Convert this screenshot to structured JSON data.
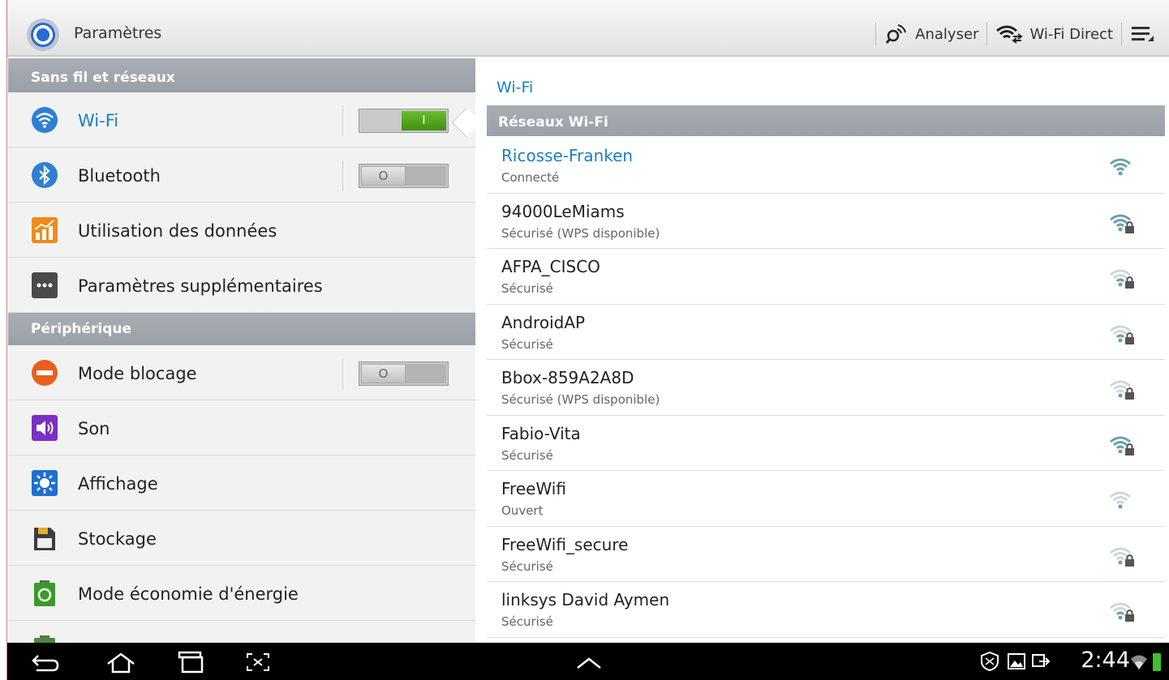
{
  "app": {
    "title": "Paramètres"
  },
  "actions": {
    "scan_label": "Analyser",
    "wifi_direct_label": "Wi-Fi Direct"
  },
  "sidebar": {
    "sections": [
      {
        "title": "Sans fil et réseaux"
      },
      {
        "title": "Périphérique"
      }
    ],
    "items": [
      {
        "label": "Wi-Fi",
        "icon": "wifi-icon",
        "toggle": "on",
        "toggle_text": "I"
      },
      {
        "label": "Bluetooth",
        "icon": "bluetooth-icon",
        "toggle": "off",
        "toggle_text": "O"
      },
      {
        "label": "Utilisation des données",
        "icon": "data-usage-icon"
      },
      {
        "label": "Paramètres supplémentaires",
        "icon": "more-settings-icon"
      },
      {
        "label": "Mode blocage",
        "icon": "blocking-mode-icon",
        "toggle": "off",
        "toggle_text": "O"
      },
      {
        "label": "Son",
        "icon": "sound-icon"
      },
      {
        "label": "Affichage",
        "icon": "display-icon"
      },
      {
        "label": "Stockage",
        "icon": "storage-icon"
      },
      {
        "label": "Mode économie d'énergie",
        "icon": "power-saving-icon"
      }
    ]
  },
  "main": {
    "title": "Wi-Fi",
    "section_title": "Réseaux Wi-Fi",
    "networks": [
      {
        "name": "Ricosse-Franken",
        "status": "Connecté",
        "signal": 4,
        "secured": false,
        "connected": true
      },
      {
        "name": "94000LeMiams",
        "status": "Sécurisé (WPS disponible)",
        "signal": 4,
        "secured": true
      },
      {
        "name": "AFPA_CISCO",
        "status": "Sécurisé",
        "signal": 2,
        "secured": true
      },
      {
        "name": "AndroidAP",
        "status": "Sécurisé",
        "signal": 2,
        "secured": true
      },
      {
        "name": "Bbox-859A2A8D",
        "status": "Sécurisé (WPS disponible)",
        "signal": 1,
        "secured": true
      },
      {
        "name": "Fabio-Vita",
        "status": "Sécurisé",
        "signal": 4,
        "secured": true
      },
      {
        "name": "FreeWifi",
        "status": "Ouvert",
        "signal": 1,
        "secured": false
      },
      {
        "name": "FreeWifi_secure",
        "status": "Sécurisé",
        "signal": 1,
        "secured": true
      },
      {
        "name": "linksys David Aymen",
        "status": "Sécurisé",
        "signal": 2,
        "secured": true
      }
    ]
  },
  "statusbar": {
    "time": "2:44"
  },
  "colors": {
    "accent": "#1a7fc4",
    "section": "#9ea4aa",
    "toggle_on": "#4fa21c"
  }
}
